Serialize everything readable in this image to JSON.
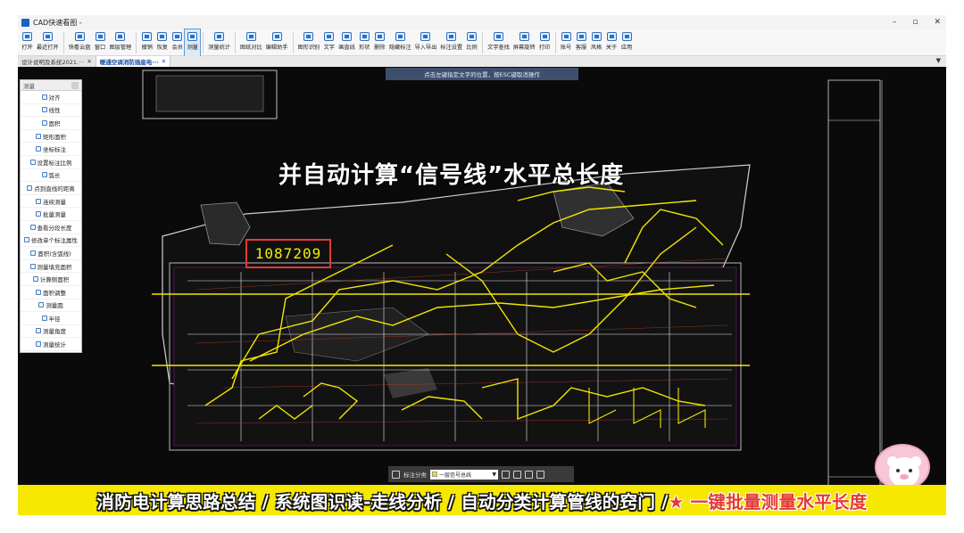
{
  "app": {
    "title": "CAD快速看图 -",
    "window_controls": [
      "–",
      "▫",
      "✕"
    ]
  },
  "toolbar": [
    {
      "label": "打开",
      "icon": "folder-icon"
    },
    {
      "label": "最近打开",
      "icon": "clock-icon"
    },
    {
      "label": "快看云盘",
      "icon": "cloud-icon"
    },
    {
      "label": "窗口",
      "icon": "window-icon"
    },
    {
      "label": "图层管理",
      "icon": "layers-icon"
    },
    {
      "label": "撤销",
      "icon": "undo-icon"
    },
    {
      "label": "恢复",
      "icon": "redo-icon"
    },
    {
      "label": "会员",
      "icon": "vip-icon"
    },
    {
      "label": "测量",
      "icon": "measure-icon",
      "active": true
    },
    {
      "label": "测量统计",
      "icon": "measure-stats-icon"
    },
    {
      "label": "图纸对比",
      "icon": "compare-icon"
    },
    {
      "label": "编辑助手",
      "icon": "edit-helper-icon"
    },
    {
      "label": "图形识别",
      "icon": "shape-recognition-icon"
    },
    {
      "label": "文字",
      "icon": "text-icon"
    },
    {
      "label": "画直线",
      "icon": "line-icon"
    },
    {
      "label": "形状",
      "icon": "shape-icon"
    },
    {
      "label": "删除",
      "icon": "eraser-icon"
    },
    {
      "label": "隐藏标注",
      "icon": "hide-icon"
    },
    {
      "label": "导入导出",
      "icon": "import-export-icon"
    },
    {
      "label": "标注设置",
      "icon": "annotation-settings-icon"
    },
    {
      "label": "比例",
      "icon": "scale-icon"
    },
    {
      "label": "文字查找",
      "icon": "text-search-icon"
    },
    {
      "label": "屏幕旋转",
      "icon": "rotate-icon"
    },
    {
      "label": "打印",
      "icon": "print-icon"
    },
    {
      "label": "账号",
      "icon": "user-icon"
    },
    {
      "label": "客服",
      "icon": "headset-icon"
    },
    {
      "label": "风格",
      "icon": "style-icon"
    },
    {
      "label": "关于",
      "icon": "info-icon"
    },
    {
      "label": "应用",
      "icon": "apps-icon"
    }
  ],
  "tabs": [
    {
      "label": "设计说明及系统2021.···",
      "active": false
    },
    {
      "label": "暖通空调消防插座电···",
      "active": true
    }
  ],
  "hint": "点击左键指定文字的位置，按ESC键取消操作",
  "panel": {
    "title": "测量",
    "items": [
      "对齐",
      "线性",
      "面积",
      "矩形面积",
      "坐标标注",
      "设置标注比例",
      "弧长",
      "点到直线的距离",
      "连续测量",
      "批量测量",
      "查看分段长度",
      "修改单个标注属性",
      "面积(含弧线)",
      "测量填充面积",
      "计算侧面积",
      "面积调整",
      "测量圆",
      "半径",
      "测量角度",
      "测量统计"
    ]
  },
  "overlay": {
    "title": "并自动计算“信号线”水平总长度",
    "measurement_value": "1087209"
  },
  "bottom_bar": {
    "label": "标注分类",
    "selected": "一层信号总线"
  },
  "caption": {
    "text": "消防电计算思路总结 / 系统图识读-走线分析 / 自动分类计算管线的窍门 / ",
    "highlight": "★ 一键批量测量水平长度"
  },
  "colors": {
    "caption_bg": "#f6e800",
    "measure_box": "#e53935",
    "cad_bg": "#0a0a0a",
    "signal_line": "#f2e600"
  }
}
